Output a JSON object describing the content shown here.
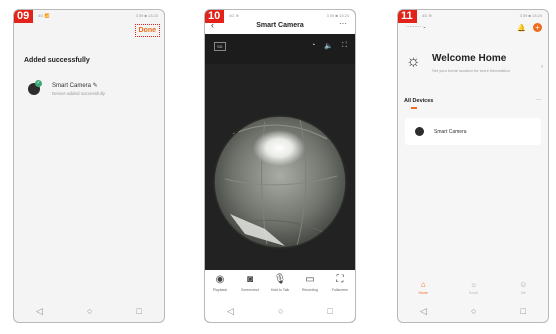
{
  "phones": [
    {
      "step": "09",
      "status_left": "4G 📶",
      "status_right": "3 59 ■ 13:23",
      "done_label": "Done",
      "title": "Added successfully",
      "device_name": "Smart Camera ✎",
      "device_subtitle": "Device added successfully",
      "nav": [
        "◁",
        "○",
        "□"
      ]
    },
    {
      "step": "10",
      "status_left": "4G ⊕",
      "status_right": "3 59 ■ 13:24",
      "back": "‹",
      "title": "Smart Camera",
      "more": "···",
      "hd_label": "SD",
      "ctrl_icons": [
        "◔",
        "🔈",
        "⛶"
      ],
      "tools": [
        {
          "icon": "◉",
          "label": "Playback"
        },
        {
          "icon": "◙",
          "label": "Screenshot"
        },
        {
          "icon": "🎙",
          "label": "Hold to Talk"
        },
        {
          "icon": "▭",
          "label": "Recording"
        },
        {
          "icon": "⛶",
          "label": "Fullscreen"
        }
      ],
      "nav": [
        "◁",
        "○",
        "□"
      ]
    },
    {
      "step": "11",
      "status_left": "4G ⊕",
      "status_right": "3 59 ■ 13:24",
      "home_label": "·········  ⌄",
      "bell": "🔔",
      "plus": "+",
      "welcome": "Welcome Home",
      "welcome_sub": "Set your home location for more information",
      "welcome_chevron": "›",
      "all_devices": "All Devices",
      "dots": "···",
      "device_name": "Smart Camera",
      "tabs": [
        {
          "icon": "⌂",
          "label": "Home"
        },
        {
          "icon": "☼",
          "label": "Smart"
        },
        {
          "icon": "☺",
          "label": "Me"
        }
      ],
      "nav": [
        "◁",
        "○",
        "□"
      ]
    }
  ]
}
